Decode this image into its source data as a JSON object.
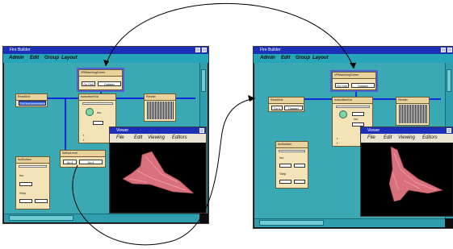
{
  "left_window": {
    "title": "Fire Builder",
    "menu": [
      "Admin",
      "Edit",
      "Group",
      "Layout"
    ],
    "modules": {
      "read": {
        "title": "ReadGrid",
        "button": "Grid test:temperature"
      },
      "volume": {
        "title": "VRMarchingCubes",
        "btn_a": "Go Grid",
        "btn_b": "Dataset"
      },
      "iso": {
        "title": "IsosurfaceCut",
        "label": "Iso"
      },
      "render": {
        "title": "Render"
      },
      "multi": {
        "title": "IsoSurface",
        "label_a": "Iso",
        "label_b": "Step"
      },
      "cut": {
        "title": "SetIsoLevel",
        "btn_a": "Go 4",
        "btn_b": "Go 4"
      }
    },
    "viewer": {
      "title": "Viewer",
      "menu": [
        "File",
        "Edit",
        "Viewing",
        "Editors"
      ]
    }
  },
  "right_window": {
    "title": "Fire Builder",
    "menu": [
      "Admin",
      "Edit",
      "Group",
      "Layout"
    ],
    "modules": {
      "read": {
        "title": "ReadGrid",
        "btn_a": "Go 4",
        "btn_b": "Dataset"
      },
      "volume": {
        "title": "VRMarchingCubes",
        "btn_a": "Go Grid",
        "btn_b": "Dataset"
      },
      "iso": {
        "title": "IsosurfaceCut",
        "label": "Iso"
      },
      "render": {
        "title": "Render"
      },
      "multi": {
        "title": "IsoSurface",
        "label_a": "Iso",
        "label_b": "Step"
      }
    },
    "viewer": {
      "title": "Viewer",
      "menu": [
        "File",
        "Edit",
        "Viewing",
        "Editors"
      ]
    }
  },
  "colors": {
    "canvas": "#3aa9b4",
    "titlebar": "#1c2fb8",
    "wire": "#0c2bd9",
    "surface": "#d9717c",
    "module": "#f4e3b6"
  }
}
